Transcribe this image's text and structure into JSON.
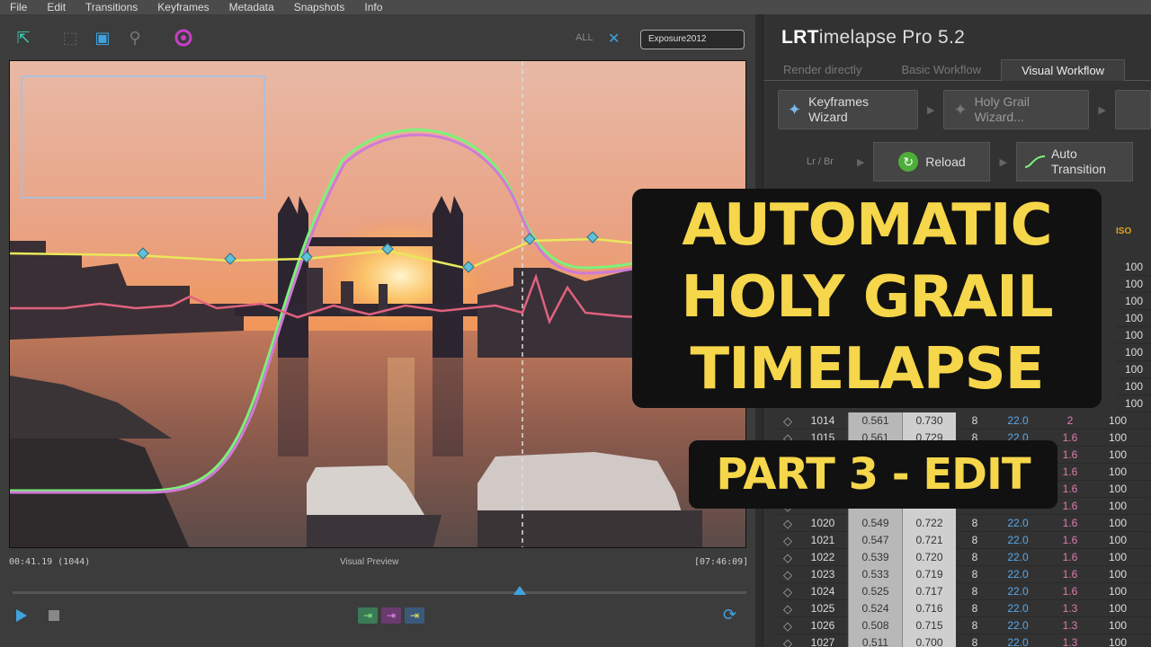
{
  "menu": [
    "File",
    "Edit",
    "Transitions",
    "Keyframes",
    "Metadata",
    "Snapshots",
    "Info"
  ],
  "toolbar": {
    "all_label": "ALL",
    "exposure_field": "Exposure2012"
  },
  "preview": {
    "label": "Visual Preview",
    "time_left": "00:41.19 (1044)",
    "time_right": "[07:46:09]"
  },
  "app": {
    "title_bold": "LRT",
    "title_rest": "imelapse Pro 5.2"
  },
  "tabs": [
    "Render directly",
    "Basic Workflow",
    "Visual Workflow"
  ],
  "wizards": {
    "keyframes_line1": "Keyframes",
    "keyframes_line2": "Wizard",
    "holygrail_line1": "Holy Grail",
    "holygrail_line2": "Wizard..."
  },
  "actions": {
    "lrbr": "Lr / Br",
    "reload": "Reload",
    "auto_line1": "Auto",
    "auto_line2": "Transition"
  },
  "table": {
    "iso_header": "ISO",
    "iso_only_rows": [
      "100",
      "100",
      "100",
      "100",
      "100",
      "100",
      "100",
      "100",
      "100"
    ],
    "rows": [
      {
        "frame": "1014",
        "v1": "0.561",
        "v2": "0.730",
        "n": "8",
        "f": "22.0",
        "ap": "2",
        "iso": "100"
      },
      {
        "frame": "1015",
        "v1": "0.561",
        "v2": "0.729",
        "n": "8",
        "f": "22.0",
        "ap": "1.6",
        "iso": "100"
      },
      {
        "frame": "",
        "v1": "",
        "v2": "",
        "n": "",
        "f": "",
        "ap": "1.6",
        "iso": "100"
      },
      {
        "frame": "",
        "v1": "",
        "v2": "",
        "n": "",
        "f": "",
        "ap": "1.6",
        "iso": "100"
      },
      {
        "frame": "",
        "v1": "",
        "v2": "",
        "n": "",
        "f": "",
        "ap": "1.6",
        "iso": "100"
      },
      {
        "frame": "",
        "v1": "",
        "v2": "",
        "n": "",
        "f": "",
        "ap": "1.6",
        "iso": "100"
      },
      {
        "frame": "1020",
        "v1": "0.549",
        "v2": "0.722",
        "n": "8",
        "f": "22.0",
        "ap": "1.6",
        "iso": "100"
      },
      {
        "frame": "1021",
        "v1": "0.547",
        "v2": "0.721",
        "n": "8",
        "f": "22.0",
        "ap": "1.6",
        "iso": "100"
      },
      {
        "frame": "1022",
        "v1": "0.539",
        "v2": "0.720",
        "n": "8",
        "f": "22.0",
        "ap": "1.6",
        "iso": "100"
      },
      {
        "frame": "1023",
        "v1": "0.533",
        "v2": "0.719",
        "n": "8",
        "f": "22.0",
        "ap": "1.6",
        "iso": "100"
      },
      {
        "frame": "1024",
        "v1": "0.525",
        "v2": "0.717",
        "n": "8",
        "f": "22.0",
        "ap": "1.6",
        "iso": "100"
      },
      {
        "frame": "1025",
        "v1": "0.524",
        "v2": "0.716",
        "n": "8",
        "f": "22.0",
        "ap": "1.3",
        "iso": "100"
      },
      {
        "frame": "1026",
        "v1": "0.508",
        "v2": "0.715",
        "n": "8",
        "f": "22.0",
        "ap": "1.3",
        "iso": "100"
      },
      {
        "frame": "1027",
        "v1": "0.511",
        "v2": "0.700",
        "n": "8",
        "f": "22.0",
        "ap": "1.3",
        "iso": "100"
      }
    ]
  },
  "overlay": {
    "line1": "AUTOMATIC",
    "line2": "HOLY GRAIL",
    "line3": "TIMELAPSE",
    "subtitle": "PART 3 - EDIT"
  },
  "colors": {
    "accent": "#3fa3e0",
    "title_yellow": "#f6d64a",
    "curve_green": "#7cf27a",
    "curve_purple": "#d07ad8",
    "curve_yellow": "#e9e85a",
    "curve_pink": "#e0627e"
  }
}
